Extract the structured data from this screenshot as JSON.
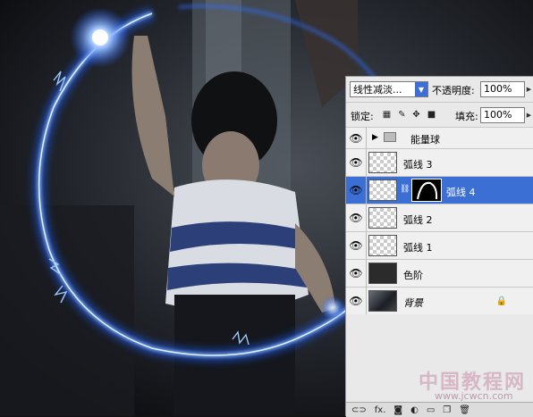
{
  "panel": {
    "blend_mode": "线性减淡...",
    "opacity_label": "不透明度:",
    "opacity_value": "100%",
    "lock_label": "锁定:",
    "fill_label": "填充:",
    "fill_value": "100%"
  },
  "layers": [
    {
      "name": "能量球",
      "type": "group",
      "visible": true
    },
    {
      "name": "弧线 3",
      "type": "layer",
      "visible": true
    },
    {
      "name": "弧线 4",
      "type": "layer",
      "visible": true,
      "selected": true,
      "has_mask": true
    },
    {
      "name": "弧线 2",
      "type": "layer",
      "visible": true
    },
    {
      "name": "弧线 1",
      "type": "layer",
      "visible": true
    },
    {
      "name": "色阶",
      "type": "adjustment",
      "visible": true
    },
    {
      "name": "背景",
      "type": "background",
      "visible": true,
      "locked": true
    }
  ],
  "bottom_bar": {
    "fx_label": "fx."
  },
  "watermark": {
    "line1": "中国教程网",
    "line2": "www.jcwcn.com"
  },
  "colors": {
    "selection": "#3c6fd4",
    "glow": "#2f7bff"
  }
}
